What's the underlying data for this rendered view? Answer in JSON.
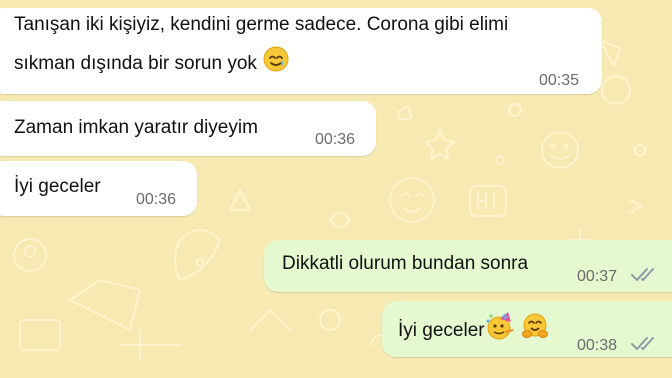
{
  "chat": {
    "messages": [
      {
        "direction": "incoming",
        "line1": "Tanışan iki kişiyiz, kendini germe sadece. Corona gibi elimi",
        "line2": "sıkman dışında bir sorun yok",
        "emoji": "sad-tear-smile-emoji",
        "time": "00:35"
      },
      {
        "direction": "incoming",
        "text": "Zaman imkan yaratır diyeyim",
        "time": "00:36"
      },
      {
        "direction": "incoming",
        "text": "İyi geceler",
        "time": "00:36"
      },
      {
        "direction": "outgoing",
        "text": "Dikkatli olurum bundan sonra",
        "time": "00:37",
        "status": "read"
      },
      {
        "direction": "outgoing",
        "text": "İyi geceler",
        "emojis": [
          "party-face-emoji",
          "hugging-face-emoji"
        ],
        "time": "00:38",
        "status": "read"
      }
    ]
  },
  "colors": {
    "wallpaper": "#f6e9b2",
    "incoming_bubble": "#ffffff",
    "outgoing_bubble": "#e6f8cf",
    "read_ticks": "#8a9aa6"
  }
}
